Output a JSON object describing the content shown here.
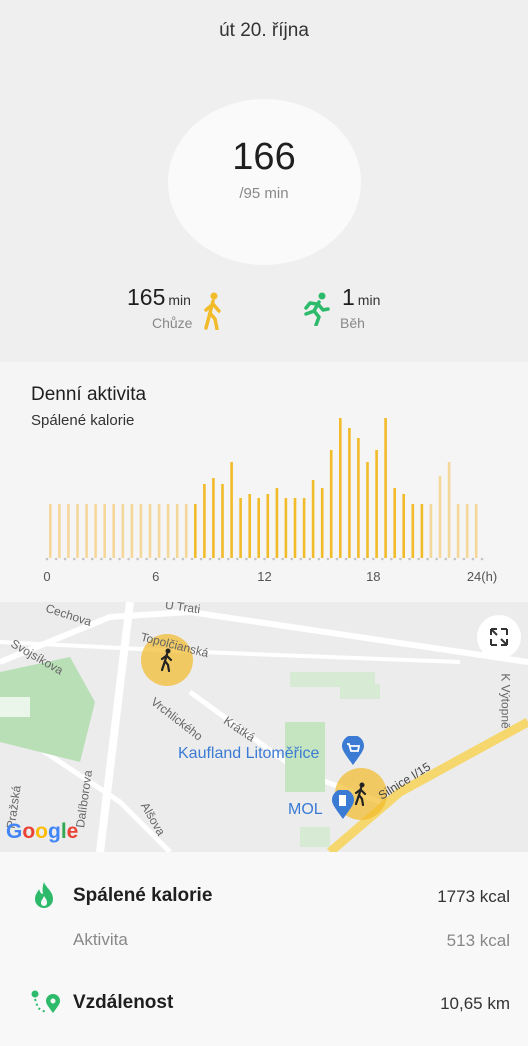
{
  "date": "út 20. října",
  "ring": {
    "value": "166",
    "goal": "/95 min"
  },
  "walk": {
    "value": "165",
    "unit": "min",
    "label": "Chůze"
  },
  "run": {
    "value": "1",
    "unit": "min",
    "label": "Běh"
  },
  "activity": {
    "title": "Denní aktivita",
    "subtitle": "Spálené kalorie"
  },
  "chart_data": {
    "type": "bar",
    "x_ticks": [
      "0",
      "6",
      "12",
      "18",
      "24(h)"
    ],
    "xlim": [
      0,
      24
    ],
    "bar_count": 48,
    "values": [
      0.27,
      0.27,
      0.27,
      0.27,
      0.27,
      0.27,
      0.27,
      0.27,
      0.27,
      0.27,
      0.27,
      0.27,
      0.27,
      0.27,
      0.27,
      0.27,
      0.27,
      0.37,
      0.4,
      0.37,
      0.48,
      0.3,
      0.32,
      0.3,
      0.32,
      0.35,
      0.3,
      0.3,
      0.3,
      0.39,
      0.35,
      0.54,
      0.7,
      0.65,
      0.6,
      0.48,
      0.54,
      0.7,
      0.35,
      0.32,
      0.27,
      0.27,
      0.27,
      0.41,
      0.48,
      0.27,
      0.27,
      0.27
    ],
    "highlight_range": [
      8,
      21
    ],
    "colors": {
      "active": "#f2bb2a",
      "inactive": "#f6d79a"
    }
  },
  "map": {
    "streets": [
      "Cechova",
      "U Trati",
      "Topolčianská",
      "Svojsíkova",
      "Vrchlického",
      "Krátká",
      "Dalíborova",
      "Alšova",
      "Pražská",
      "Silnice I/15",
      "K Výtopně"
    ],
    "poi": [
      "Kaufland Litoměřice",
      "MOL"
    ],
    "logo": "Google"
  },
  "summary": {
    "calories": {
      "label": "Spálené kalorie",
      "value": "1773 kcal"
    },
    "active": {
      "label": "Aktivita",
      "value": "513 kcal"
    },
    "distance": {
      "label": "Vzdálenost",
      "value": "10,65 km"
    }
  },
  "colors": {
    "walk": "#f2bb2a",
    "run": "#2dbb6b",
    "accent_green": "#2dbb6b"
  }
}
